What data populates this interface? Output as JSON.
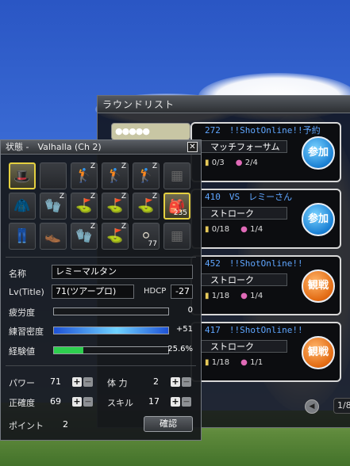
{
  "round_list": {
    "title": "ラウンドリスト",
    "balls": "●●●●●",
    "rooms": [
      {
        "number": "272",
        "name": "!!ShotOnline!!予約",
        "mode": "マッチフォーサム",
        "ball_count": "0/3",
        "players": "2/4",
        "action": "参加",
        "action_type": "join"
      },
      {
        "number": "410",
        "name": "VS　レミーさん",
        "mode": "ストローク",
        "ball_count": "0/18",
        "players": "1/4",
        "action": "参加",
        "action_type": "join"
      },
      {
        "number": "452",
        "name": "!!ShotOnline!!",
        "mode": "ストローク",
        "ball_count": "1/18",
        "players": "1/4",
        "action": "観戦",
        "action_type": "watch"
      },
      {
        "number": "417",
        "name": "!!ShotOnline!!",
        "mode": "ストローク",
        "ball_count": "1/18",
        "players": "1/1",
        "action": "観戦",
        "action_type": "watch"
      }
    ],
    "page": "1/8"
  },
  "status": {
    "title": "状態 -　Valhalla (Ch 2)",
    "close": "✕",
    "inventory": [
      {
        "icon": "cap-icon",
        "glyph": "🎩",
        "selected": true
      },
      {
        "icon": "empty-slot-icon",
        "glyph": "",
        "dim": true
      },
      {
        "icon": "driver-icon",
        "glyph": "🏌",
        "z": "Z"
      },
      {
        "icon": "wood-icon",
        "glyph": "🏌",
        "z": "Z"
      },
      {
        "icon": "iron-icon",
        "glyph": "🏌",
        "z": "Z"
      },
      {
        "icon": "locked-slot-icon",
        "glyph": "▦",
        "dim": true
      },
      {
        "icon": "jacket-icon",
        "glyph": "🧥"
      },
      {
        "icon": "glove-icon",
        "glyph": "🧤",
        "z": "Z"
      },
      {
        "icon": "wedge-icon",
        "glyph": "⛳",
        "z": "Z"
      },
      {
        "icon": "wedge2-icon",
        "glyph": "⛳",
        "z": "Z"
      },
      {
        "icon": "wedge3-icon",
        "glyph": "⛳",
        "z": "Z"
      },
      {
        "icon": "tee-bag-icon",
        "glyph": "🎒",
        "count": "235",
        "selected": true
      },
      {
        "icon": "pants-icon",
        "glyph": "👖"
      },
      {
        "icon": "shoes-icon",
        "glyph": "👞"
      },
      {
        "icon": "putter-glove-icon",
        "glyph": "🧤",
        "z": "Z"
      },
      {
        "icon": "putter-icon",
        "glyph": "⛳",
        "z": "Z"
      },
      {
        "icon": "ball-icon",
        "glyph": "⚪",
        "count": "77"
      },
      {
        "icon": "locked-slot2-icon",
        "glyph": "▦",
        "dim": true
      }
    ],
    "name_label": "名称",
    "name_value": "レミーマルタン",
    "lv_label": "Lv(Title)",
    "lv_value": "71(ツアープロ)",
    "hdcp_label": "HDCP",
    "hdcp_value": "-27",
    "fatigue_label": "疲労度",
    "fatigue_value": "0",
    "fatigue_pct": 0,
    "practice_label": "練習密度",
    "practice_value": "+51",
    "practice_pct": 100,
    "exp_label": "経験値",
    "exp_value": "25.6%",
    "exp_pct": 25.6,
    "stats": [
      {
        "label": "パワー",
        "value": "71"
      },
      {
        "label": "体 力",
        "value": "2"
      },
      {
        "label": "正確度",
        "value": "69"
      },
      {
        "label": "スキル",
        "value": "17"
      }
    ],
    "points_label": "ポイント",
    "points_value": "2",
    "confirm": "確認",
    "plus": "+",
    "minus": "−"
  },
  "colors": {
    "fatigue": "#2a2c30",
    "practice_start": "#1e52d6",
    "practice_end": "#6fd3ff",
    "exp": "#2ecf4f",
    "room_name": "#5fa6ff"
  }
}
